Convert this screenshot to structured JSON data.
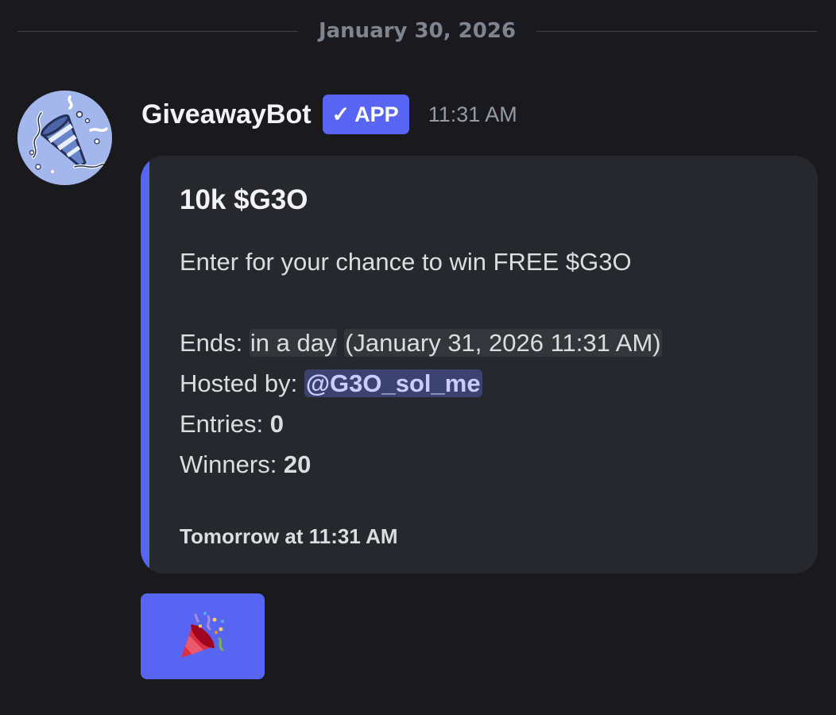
{
  "divider": {
    "date": "January 30, 2026"
  },
  "message": {
    "username": "GiveawayBot",
    "badge": {
      "check": "✓",
      "label": "APP"
    },
    "time": "11:31 AM",
    "avatar_icon": "party-popper-icon"
  },
  "embed": {
    "accent_color": "#5865f2",
    "title": "10k $G3O",
    "description": "Enter for your chance to win FREE $G3O",
    "ends_label": "Ends: ",
    "ends_relative": "in a day",
    "ends_absolute": "(January 31, 2026 11:31 AM)",
    "hosted_label": "Hosted by: ",
    "host_mention": "@G3O_sol_me",
    "entries_label": "Entries: ",
    "entries_value": "0",
    "winners_label": "Winners: ",
    "winners_value": "20",
    "footer": "Tomorrow at 11:31 AM"
  },
  "button": {
    "emoji": "party-popper-icon",
    "color": "#5865f2"
  }
}
